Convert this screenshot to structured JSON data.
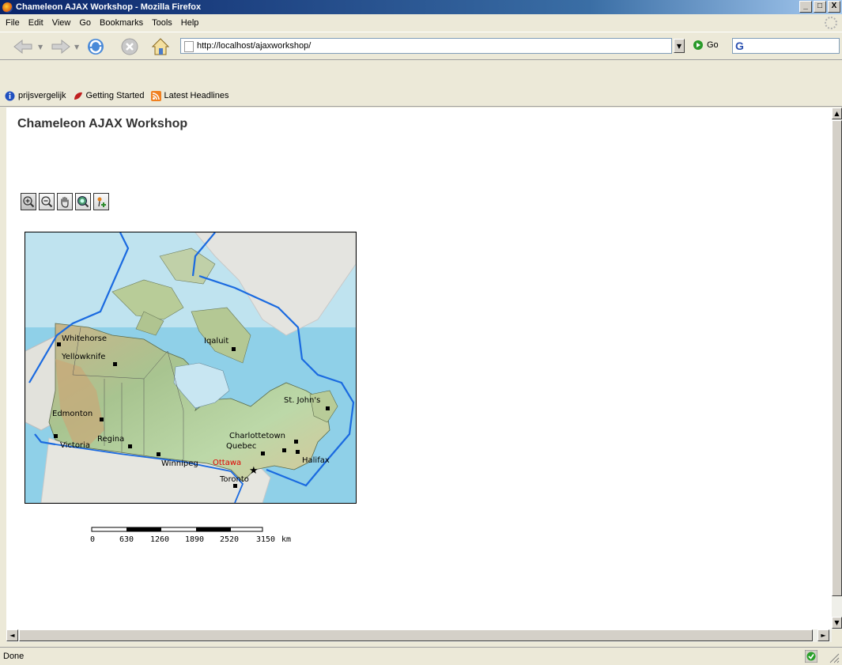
{
  "window": {
    "title": "Chameleon AJAX Workshop - Mozilla Firefox",
    "min": "_",
    "max": "□",
    "close": "X"
  },
  "menu": [
    "File",
    "Edit",
    "View",
    "Go",
    "Bookmarks",
    "Tools",
    "Help"
  ],
  "navbar": {
    "url": "http://localhost/ajaxworkshop/",
    "go_label": "Go"
  },
  "bookmarks": [
    "prijsvergelijk",
    "Getting Started",
    "Latest Headlines"
  ],
  "page": {
    "title": "Chameleon AJAX Workshop"
  },
  "map": {
    "cities": [
      "Whitehorse",
      "Yellowknife",
      "Iqaluit",
      "St. John's",
      "Edmonton",
      "Victoria",
      "Regina",
      "Winnipeg",
      "Ottawa",
      "Charlottetown",
      "Quebec",
      "Halifax",
      "Toronto"
    ],
    "capital_color": "#e00000"
  },
  "scalebar": {
    "labels": [
      "0",
      "630",
      "1260",
      "1890",
      "2520",
      "3150"
    ],
    "unit": "km"
  },
  "status": {
    "text": "Done"
  }
}
